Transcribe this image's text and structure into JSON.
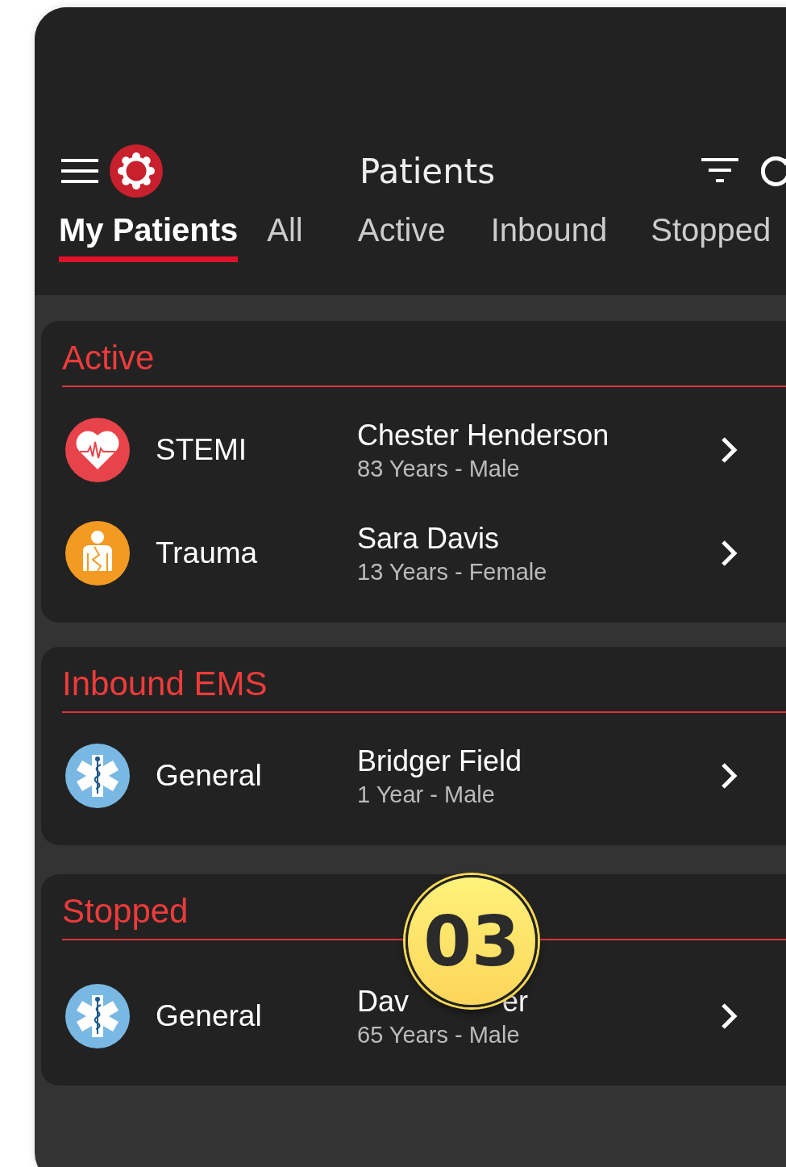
{
  "header": {
    "title": "Patients"
  },
  "tabs": [
    {
      "label": "My Patients",
      "selected": true
    },
    {
      "label": "All",
      "selected": false
    },
    {
      "label": "Active",
      "selected": false
    },
    {
      "label": "Inbound",
      "selected": false
    },
    {
      "label": "Stopped",
      "selected": false
    }
  ],
  "sections": [
    {
      "title": "Active",
      "patients": [
        {
          "kind": "stemi",
          "category": "STEMI",
          "name": "Chester Henderson",
          "details": "83 Years - Male"
        },
        {
          "kind": "trauma",
          "category": "Trauma",
          "name": "Sara Davis",
          "details": "13 Years - Female"
        }
      ]
    },
    {
      "title": "Inbound EMS",
      "patients": [
        {
          "kind": "ems",
          "category": "General",
          "name": "Bridger Field",
          "details": "1 Year - Male"
        }
      ]
    },
    {
      "title": "Stopped",
      "patients": [
        {
          "kind": "ems",
          "category": "General",
          "name_parts": [
            "Dav",
            "er"
          ],
          "details": "65 Years - Male"
        }
      ]
    }
  ],
  "step_badge": {
    "label": "03"
  }
}
